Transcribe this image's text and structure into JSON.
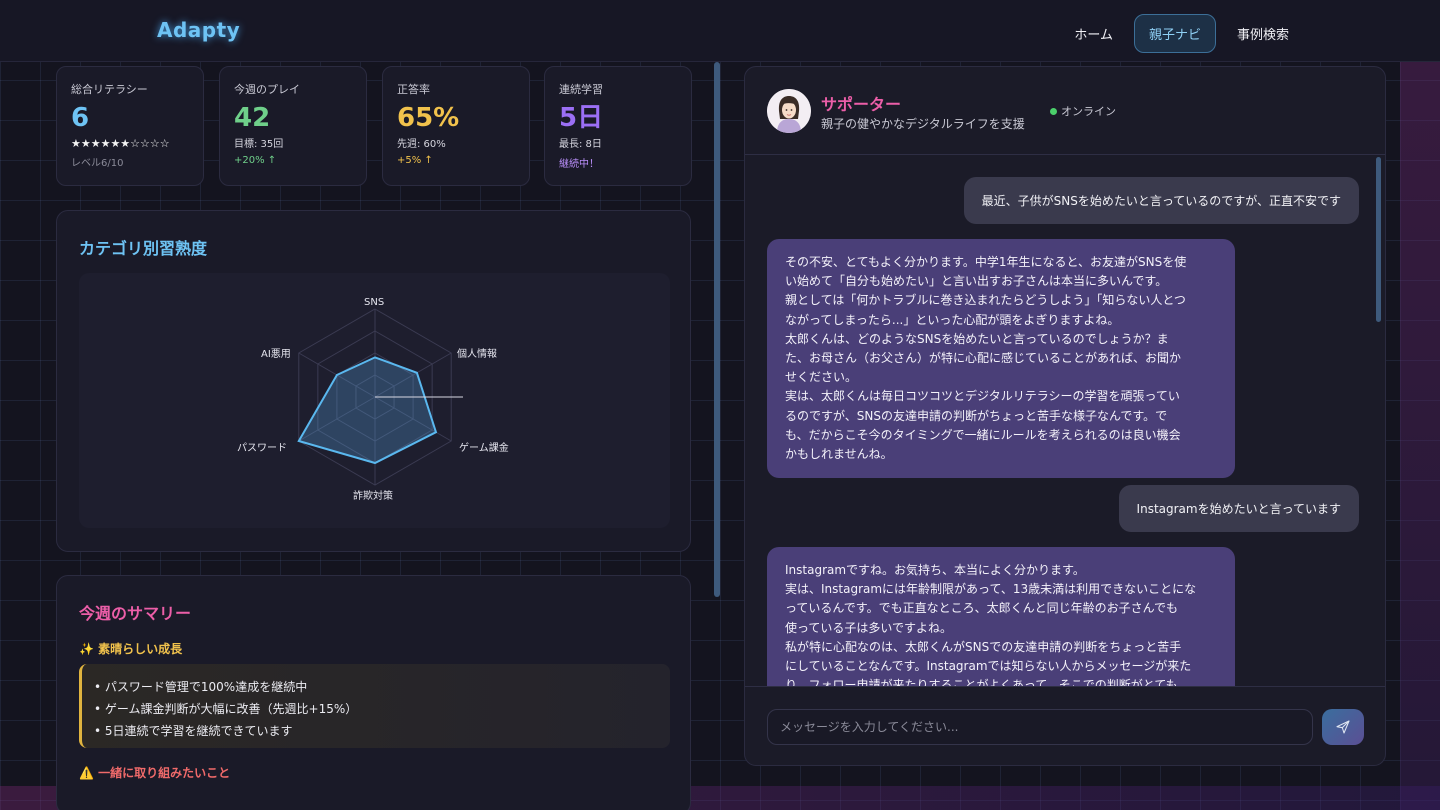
{
  "app": {
    "logo": "Adapty"
  },
  "nav": {
    "items": [
      "ホーム",
      "親子ナビ",
      "事例検索"
    ],
    "active_index": 1
  },
  "stats": [
    {
      "label": "総合リテラシー",
      "value": "6",
      "color": "#6ec3f4",
      "stars": "★★★★★★☆☆☆☆",
      "level": "レベル6/10"
    },
    {
      "label": "今週のプレイ",
      "value": "42",
      "color": "#6fcf8a",
      "sub": "目標: 35回",
      "delta": "+20% ↑",
      "delta_color": "#6fcf8a"
    },
    {
      "label": "正答率",
      "value": "65%",
      "color": "#f1c24c",
      "sub": "先週: 60%",
      "delta": "+5% ↑",
      "delta_color": "#f1c24c"
    },
    {
      "label": "連続学習",
      "value": "5日",
      "color": "#9b6ff5",
      "sub": "最長: 8日",
      "delta": "継続中！",
      "delta_color": "#b98ef9"
    }
  ],
  "radar": {
    "title": "カテゴリ別習熟度",
    "title_color": "#6ec3f4",
    "axes": [
      "SNS",
      "個人情報",
      "ゲーム課金",
      "詐欺対策",
      "パスワード",
      "AI悪用"
    ],
    "values": [
      0.45,
      0.55,
      0.8,
      0.75,
      1.0,
      0.5
    ],
    "max": 1.0
  },
  "summary": {
    "title": "今週のサマリー",
    "title_color": "#ec5ea8",
    "growth_heading": "✨ 素晴らしい成長",
    "growth_items": [
      "• パスワード管理で100%達成を継続中",
      "• ゲーム課金判断が大幅に改善（先週比+15%）",
      "• 5日連続で学習を継続できています"
    ],
    "together_heading": "⚠️ 一緒に取り組みたいこと"
  },
  "chat": {
    "name": "サポーター",
    "description": "親子の健やかなデジタルライフを支援",
    "status": "オンライン",
    "messages": [
      {
        "role": "user",
        "text": "最近、子供がSNSを始めたいと言っているのですが、正直不安です"
      },
      {
        "role": "bot",
        "lines": [
          "その不安、とてもよく分かります。中学1年生になると、お友達がSNSを使",
          "い始めて「自分も始めたい」と言い出すお子さんは本当に多いんです。",
          "親としては「何かトラブルに巻き込まれたらどうしよう」「知らない人とつ",
          "ながってしまったら...」といった心配が頭をよぎりますよね。",
          "太郎くんは、どのようなSNSを始めたいと言っているのでしょうか？ま",
          "た、お母さん（お父さん）が特に心配に感じていることがあれば、お聞か",
          "せください。",
          "実は、太郎くんは毎日コツコツとデジタルリテラシーの学習を頑張ってい",
          "るのですが、SNSの友達申請の判断がちょっと苦手な様子なんです。で",
          "も、だからこそ今のタイミングで一緒にルールを考えられるのは良い機会",
          "かもしれませんね。"
        ]
      },
      {
        "role": "user",
        "text": "Instagramを始めたいと言っています"
      },
      {
        "role": "bot",
        "lines": [
          "Instagramですね。お気持ち、本当によく分かります。",
          "実は、Instagramには年齢制限があって、13歳未満は利用できないことにな",
          "っているんです。でも正直なところ、太郎くんと同じ年齢のお子さんでも",
          "使っている子は多いですよね。",
          "私が特に心配なのは、太郎くんがSNSでの友達申請の判断をちょっと苦手",
          "にしていることなんです。Instagramでは知らない人からメッセージが来た",
          "り、フォロー申請が来たりすることがよくあって、そこでの判断がとても"
        ]
      }
    ],
    "input_placeholder": "メッセージを入力してください..."
  },
  "icons": {
    "send": "send-icon",
    "avatar": "avatar-icon"
  }
}
